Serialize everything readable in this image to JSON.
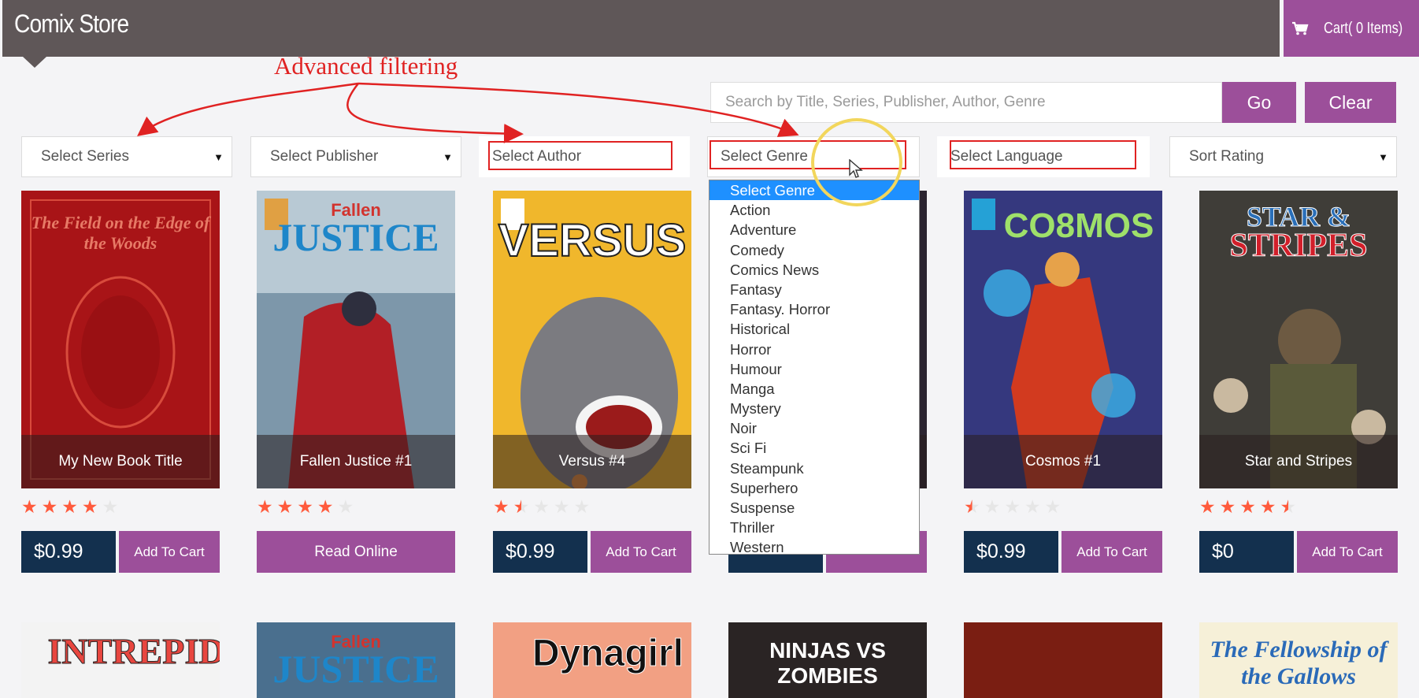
{
  "header": {
    "brand": "Comix Store",
    "cart_label": "Cart( 0 Items)",
    "cart_icon": "shopping-cart-icon"
  },
  "annotation": {
    "text": "Advanced filtering"
  },
  "search": {
    "placeholder": "Search by Title, Series, Publisher, Author, Genre",
    "go_label": "Go",
    "clear_label": "Clear"
  },
  "filters": {
    "series": "Select Series",
    "publisher": "Select Publisher",
    "author": "Select Author",
    "genre": "Select Genre",
    "language": "Select Language",
    "sort": "Sort Rating"
  },
  "genre_dropdown": {
    "options": [
      "Select Genre",
      "Action",
      "Adventure",
      "Comedy",
      "Comics News",
      "Fantasy",
      "Fantasy. Horror",
      "Historical",
      "Horror",
      "Humour",
      "Manga",
      "Mystery",
      "Noir",
      "Sci Fi",
      "Steampunk",
      "Superhero",
      "Suspense",
      "Thriller",
      "Western"
    ],
    "selected": "Select Genre"
  },
  "comics": [
    {
      "title": "My New Book Title",
      "rating": 4,
      "price": "$0.99",
      "action": "Add To Cart",
      "cover_text": "The Field on the Edge of the Woods",
      "cover_color": "#b3171a"
    },
    {
      "title": "Fallen Justice #1",
      "rating": 4,
      "price": "",
      "action": "Read Online",
      "cover_text": "Fallen JUSTICE",
      "cover_color": "#4a6f8e"
    },
    {
      "title": "Versus #4",
      "rating": 1.5,
      "price": "$0.99",
      "action": "Add To Cart",
      "cover_text": "VERSUS",
      "cover_color": "#e8b22a"
    },
    {
      "title": "",
      "rating": 0,
      "price": "",
      "action": "",
      "cover_text": "",
      "cover_color": "#2b2430"
    },
    {
      "title": "Cosmos #1",
      "rating": 0.5,
      "price": "$0.99",
      "action": "Add To Cart",
      "cover_text": "CO8MOS",
      "cover_color": "#3a3f8a"
    },
    {
      "title": "Star and Stripes",
      "rating": 4.5,
      "price": "$0",
      "action": "Add To Cart",
      "cover_text": "STAR & STRIPES",
      "cover_color": "#4b4a44"
    }
  ],
  "row2": [
    {
      "cover_text": "INTREPID",
      "cover_color": "#f3f3f3"
    },
    {
      "cover_text": "Fallen JUSTICE",
      "cover_color": "#4a6f8e"
    },
    {
      "cover_text": "Dynagirl",
      "cover_color": "#f2a083"
    },
    {
      "cover_text": "NINJAS VS ZOMBIES",
      "cover_color": "#2a2424"
    },
    {
      "cover_text": "",
      "cover_color": "#7a1e12"
    },
    {
      "cover_text": "The Fellowship of the Gallows",
      "cover_color": "#f6f0d8"
    }
  ],
  "colors": {
    "header_bg": "#5f5758",
    "accent_purple": "#9c4f9a",
    "price_navy": "#13304e",
    "star_orange": "#ff5a3c",
    "annotation_red": "#e02222",
    "selected_blue": "#1e90ff"
  }
}
